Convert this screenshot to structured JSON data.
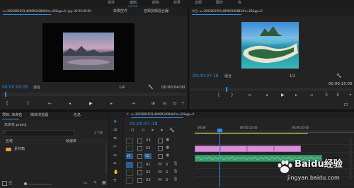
{
  "workspaces": {
    "tabs": [
      "组件",
      "编辑",
      "颜色",
      "效果",
      "音频",
      "图形",
      "库"
    ],
    "active_index": 1
  },
  "source_monitor": {
    "tabs": [
      "u=3002802993,4898934084&fm=26&gp=0 .jpg: 00:00:00:00",
      "效果控件",
      "音频剪辑混合器"
    ],
    "timecode_left": "00:00:00:05",
    "fit": "适合",
    "scale": "1/4",
    "timecode_right": "00:00:04:00"
  },
  "program_monitor": {
    "title": "节目: u=3002802993,4898934084&fm=26&gp=0",
    "timecode_left": "00:00:07:18",
    "fit": "适合",
    "scale": "1/2",
    "timecode_right": "00:00:15:00"
  },
  "project_panel": {
    "tabs": [
      "项目: 未命名",
      "媒体浏览器",
      "信息"
    ],
    "file": "未命名.prproj",
    "item_count": "1 个项",
    "column_name": "名称",
    "column_fps": "帧速率",
    "bin_label": "素材箱"
  },
  "timeline": {
    "title": "u=3002802993,4898934084&fm=26&gp=0",
    "timecode": "00:00:07:18",
    "ruler": [
      "00:00",
      "00:00:15:00",
      "00:00:30:00"
    ],
    "video_tracks": [
      "V3",
      "V2",
      "V1"
    ],
    "audio_tracks": [
      "A1",
      "A2",
      "A3"
    ],
    "track_letters": {
      "toggle": "V1",
      "mute": "M",
      "solo": "S"
    }
  },
  "watermark": {
    "brand": "Baidu经验",
    "url": "jingyan.baidu.com"
  },
  "colors": {
    "accent": "#2d8ceb",
    "video_clip": "#d98fdc",
    "audio_clip": "#3a9a6a",
    "playhead": "#2d8ceb",
    "workarea": "#d4c844"
  },
  "icons": [
    "wrench-icon",
    "play-icon",
    "step-back-icon",
    "step-forward-icon",
    "mark-in-icon",
    "mark-out-icon",
    "insert-icon",
    "overwrite-icon",
    "export-frame-icon",
    "add-icon",
    "selection-tool-icon",
    "ripple-tool-icon",
    "razor-tool-icon",
    "slip-tool-icon",
    "pen-tool-icon",
    "hand-tool-icon",
    "type-tool-icon",
    "folder-icon",
    "lock-icon",
    "eye-icon",
    "mic-icon"
  ]
}
